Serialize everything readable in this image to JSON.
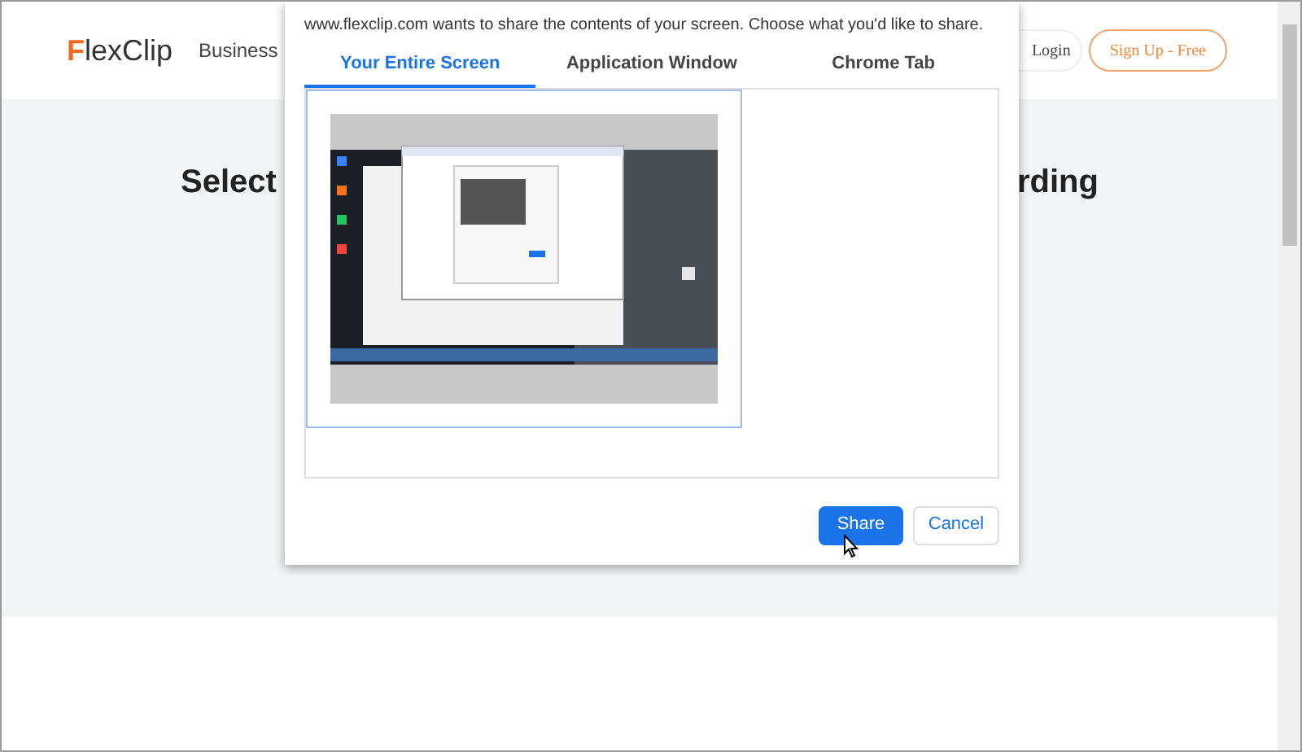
{
  "header": {
    "logo": "FlexClip",
    "nav": [
      {
        "label": "Business"
      }
    ],
    "login": "Login",
    "signup": "Sign Up - Free"
  },
  "headline_parts": [
    "Select",
    "rding"
  ],
  "dialog": {
    "message": "www.flexclip.com wants to share the contents of your screen. Choose what you'd like to share.",
    "tabs": [
      {
        "label": "Your Entire Screen",
        "selected": true
      },
      {
        "label": "Application Window",
        "selected": false
      },
      {
        "label": "Chrome Tab",
        "selected": false
      }
    ],
    "screens": [
      {
        "kind": "picture",
        "selected": true
      }
    ],
    "buttons": [
      {
        "label": "Share",
        "kind": "primary"
      },
      {
        "label": "Cancel",
        "kind": "secondary"
      }
    ]
  }
}
